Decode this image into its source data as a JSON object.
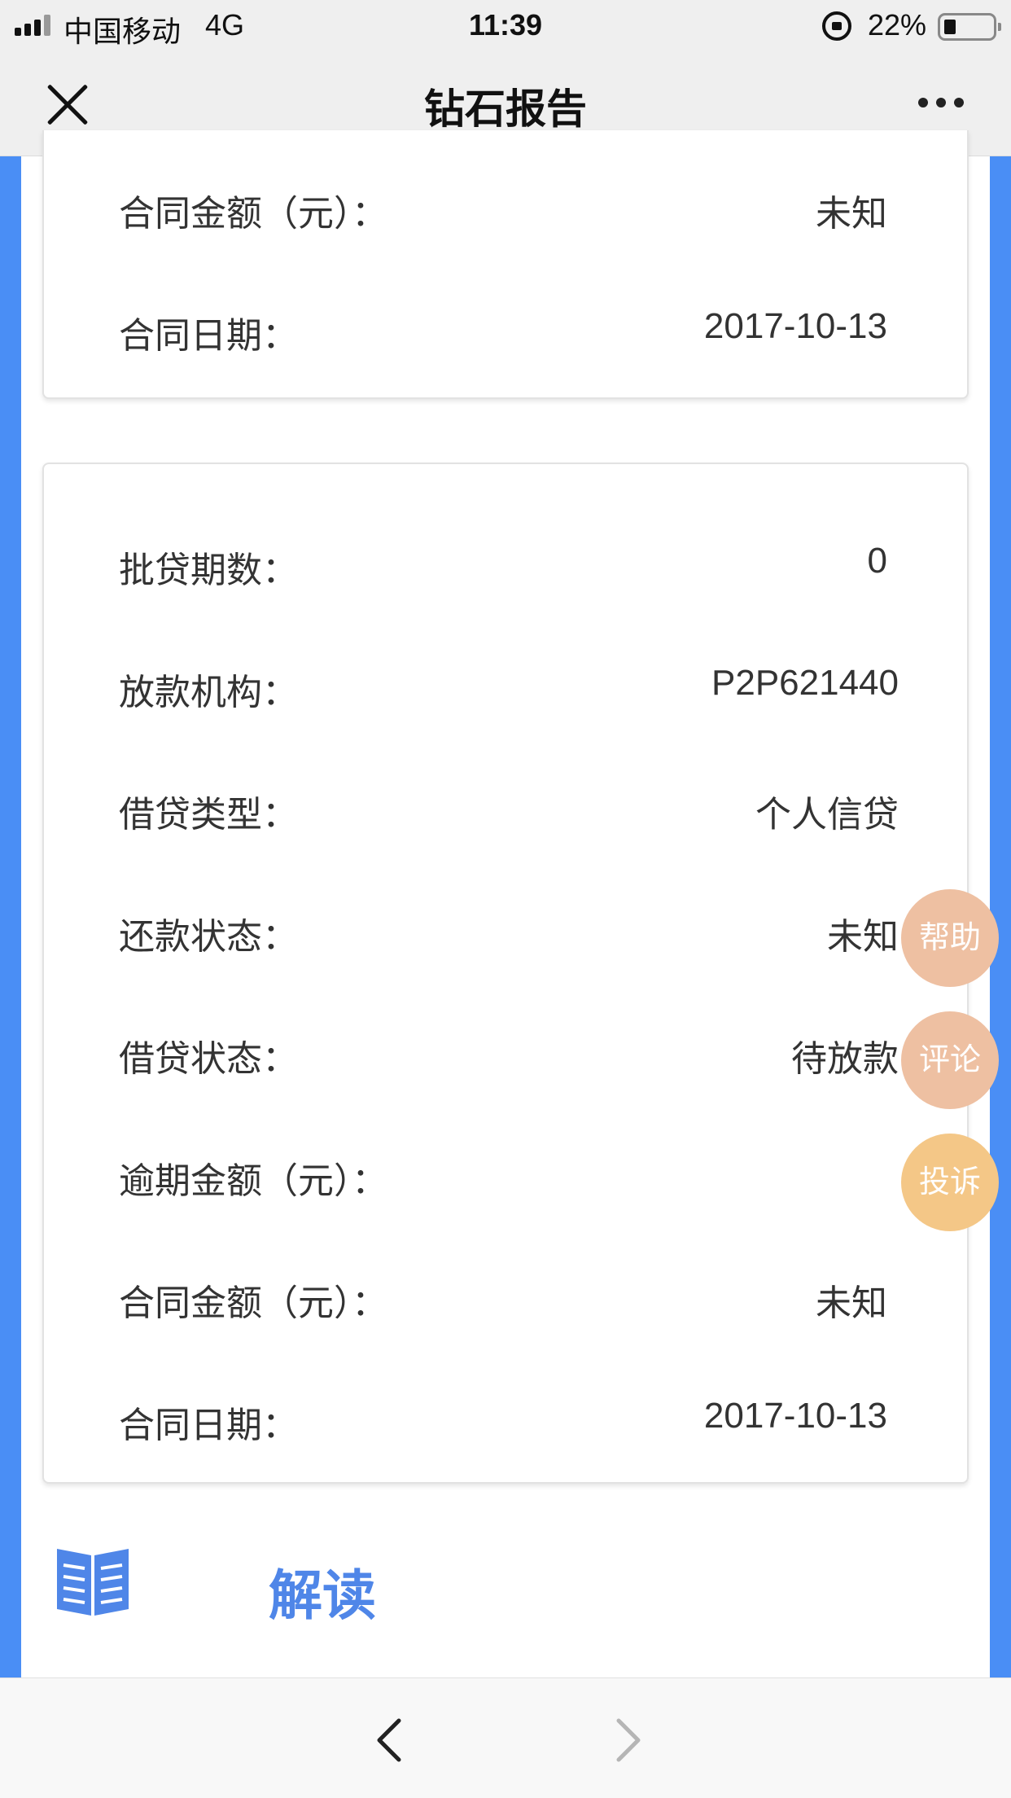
{
  "status_bar": {
    "carrier": "中国移动",
    "network": "4G",
    "time": "11:39",
    "battery": "22%",
    "icons": [
      "signal-icon",
      "orientation-lock-icon",
      "battery-icon"
    ]
  },
  "nav": {
    "title": "钻石报告",
    "close_icon": "close-icon",
    "more_icon": "more-icon"
  },
  "card_top": {
    "rows": [
      {
        "label": "合同金额（元）：",
        "value": "未知"
      },
      {
        "label": "合同日期：",
        "value": "2017-10-13"
      }
    ]
  },
  "card_main": {
    "rows": [
      {
        "label": "批贷期数：",
        "value": "0"
      },
      {
        "label": "放款机构：",
        "value": "P2P621440"
      },
      {
        "label": "借贷类型：",
        "value": "个人信贷"
      },
      {
        "label": "还款状态：",
        "value": "未知"
      },
      {
        "label": "借贷状态：",
        "value": "待放款"
      },
      {
        "label": "逾期金额（元）：",
        "value": ""
      },
      {
        "label": "合同金额（元）：",
        "value": "未知"
      },
      {
        "label": "合同日期：",
        "value": "2017-10-13"
      }
    ]
  },
  "floating_buttons": {
    "help": "帮助",
    "comment": "评论",
    "complain": "投诉"
  },
  "interpret": {
    "label": "解读",
    "icon": "book-icon"
  },
  "toolbar": {
    "back_icon": "chevron-left-icon",
    "forward_icon": "chevron-right-icon"
  },
  "colors": {
    "accent_blue": "#4a8ef5",
    "interpret_blue": "#4f86e8",
    "help_button": "#eec0a2",
    "complain_button": "#f4c787"
  }
}
